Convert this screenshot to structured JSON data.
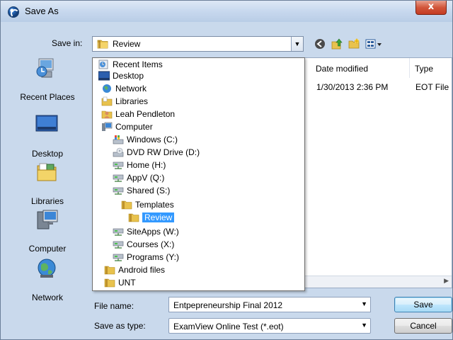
{
  "window": {
    "title": "Save As",
    "close_glyph": "x"
  },
  "toolbar": {
    "save_in_label": "Save in:",
    "save_in_value": "Review",
    "nav_icons": [
      "back-icon",
      "up-folder-icon",
      "new-folder-icon",
      "views-icon"
    ]
  },
  "places": [
    {
      "label": "Recent Places",
      "icon": "recent-places-icon"
    },
    {
      "label": "Desktop",
      "icon": "desktop-icon"
    },
    {
      "label": "Libraries",
      "icon": "libraries-icon"
    },
    {
      "label": "Computer",
      "icon": "computer-icon"
    },
    {
      "label": "Network",
      "icon": "network-icon"
    }
  ],
  "filelist": {
    "columns": [
      "Date modified",
      "Type"
    ],
    "rows": [
      {
        "date": "1/30/2013 2:36 PM",
        "type": "EOT File"
      }
    ]
  },
  "dropdown": {
    "items": [
      {
        "label": "Recent Items",
        "icon": "recent-items-icon"
      },
      {
        "label": "Desktop",
        "icon": "desktop-icon"
      },
      {
        "label": "Network",
        "icon": "network-icon"
      },
      {
        "label": "Libraries",
        "icon": "libraries-icon"
      },
      {
        "label": "Leah Pendleton",
        "icon": "user-folder-icon"
      },
      {
        "label": "Computer",
        "icon": "computer-icon"
      },
      {
        "label": "Windows (C:)",
        "icon": "windows-drive-icon"
      },
      {
        "label": "DVD RW Drive (D:)",
        "icon": "dvd-drive-icon"
      },
      {
        "label": "Home (H:)",
        "icon": "network-drive-icon"
      },
      {
        "label": "AppV (Q:)",
        "icon": "network-drive-icon"
      },
      {
        "label": "Shared (S:)",
        "icon": "network-drive-icon"
      },
      {
        "label": "Templates",
        "icon": "folder-icon"
      },
      {
        "label": "Review",
        "icon": "folder-icon",
        "selected": true
      },
      {
        "label": "SiteApps (W:)",
        "icon": "network-drive-icon"
      },
      {
        "label": "Courses (X:)",
        "icon": "network-drive-icon"
      },
      {
        "label": "Programs (Y:)",
        "icon": "network-drive-icon"
      },
      {
        "label": "Android files",
        "icon": "folder-icon"
      },
      {
        "label": "UNT",
        "icon": "folder-icon"
      }
    ]
  },
  "form": {
    "file_name_label": "File name:",
    "file_name_value": "Entpepreneurship Final 2012",
    "save_as_type_label": "Save as type:",
    "save_as_type_value": "ExamView Online Test (*.eot)"
  },
  "buttons": {
    "save": "Save",
    "cancel": "Cancel"
  },
  "colors": {
    "selection": "#3399ff",
    "dialog_bg": "#c9d9ec",
    "close": "#c43b22"
  }
}
